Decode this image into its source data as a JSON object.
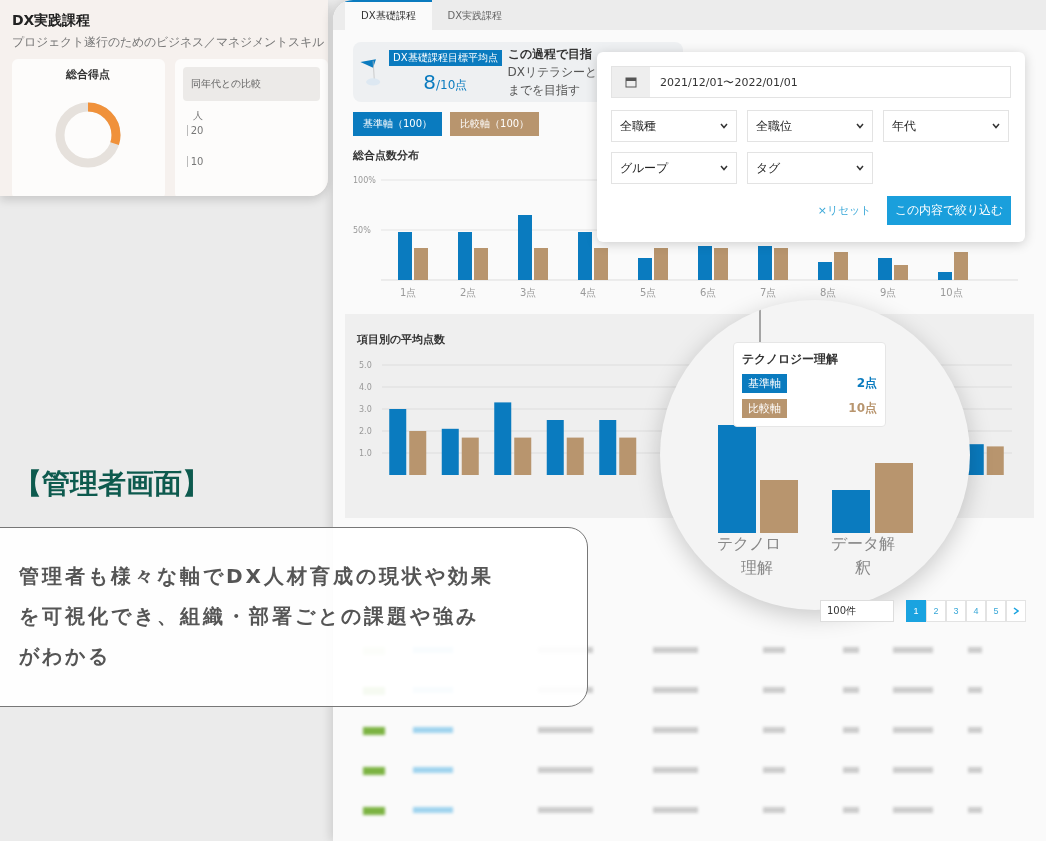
{
  "back_screen": {
    "title": "DX実践課程",
    "subtitle": "プロジェクト遂行のためのビジネス／マネジメントスキル",
    "score_card": {
      "title": "総合得点",
      "level": 0.3
    },
    "comparison_card": {
      "title": "同年代との比較",
      "unit": "人",
      "yticks": [
        "20",
        "10"
      ]
    }
  },
  "main_screen": {
    "tabs": [
      {
        "label": "DX基礎課程",
        "selected": true
      },
      {
        "label": "DX実践課程",
        "selected": false
      }
    ],
    "goal": {
      "badge": "DX基礎課程目標平均点",
      "score": "8",
      "max": "/10点",
      "heading": "この過程で目指",
      "lines": [
        "DXリテラシーと",
        "までを目指す"
      ]
    },
    "axes": [
      {
        "label": "基準軸（100）",
        "color": "#0a7bbf"
      },
      {
        "label": "比較軸（100）",
        "color": "#b8956e"
      }
    ],
    "distribution": {
      "title": "総合点数分布",
      "chart_data": {
        "type": "bar",
        "categories": [
          "1点",
          "2点",
          "3点",
          "4点",
          "5点",
          "6点",
          "7点",
          "8点",
          "9点",
          "10点"
        ],
        "series": [
          {
            "color": "#0a7bbf",
            "values": [
              48,
              48,
              65,
              48,
              22,
              34,
              34,
              18,
              22,
              8
            ]
          },
          {
            "color": "#b8956e",
            "values": [
              32,
              32,
              32,
              32,
              32,
              32,
              32,
              28,
              15,
              28
            ]
          }
        ],
        "ylim": [
          0,
          100
        ],
        "yticks": [
          {
            "value": 50,
            "label": "50%"
          },
          {
            "value": 100,
            "label": "100%"
          }
        ],
        "grid": true
      }
    },
    "filter": {
      "date": "2021/12/01〜2022/01/01",
      "selects": [
        "全職種",
        "全職位",
        "年代",
        "グループ",
        "タグ"
      ],
      "reset": "×リセット",
      "apply": "この内容で絞り込む"
    },
    "item_scores": {
      "title": "項目別の平均点数",
      "chart_data": {
        "type": "bar",
        "series": [
          {
            "color": "#0a7bbf",
            "values": [
              3.0,
              2.1,
              3.3,
              2.5,
              2.5,
              null,
              null,
              null,
              null,
              null,
              null,
              1.4
            ]
          },
          {
            "color": "#b8956e",
            "values": [
              2.0,
              1.7,
              1.7,
              1.7,
              1.7,
              null,
              null,
              null,
              null,
              null,
              null,
              1.3
            ]
          }
        ],
        "ylim": [
          0,
          5
        ],
        "yticks": [
          {
            "value": 1,
            "label": "1.0"
          },
          {
            "value": 2,
            "label": "2.0"
          },
          {
            "value": 3,
            "label": "3.0"
          },
          {
            "value": 4,
            "label": "4.0"
          },
          {
            "value": 5,
            "label": "5.0"
          }
        ],
        "grid": true
      }
    },
    "magnifier": {
      "title": "テクノロジー理解",
      "rows": [
        {
          "label": "基準軸",
          "value": "2点",
          "color": "#0a7bbf"
        },
        {
          "label": "比較軸",
          "value": "10点",
          "color": "#b8956e"
        }
      ],
      "labels": [
        [
          "テクノロ",
          "理解"
        ],
        [
          "データ解",
          "釈"
        ]
      ]
    },
    "pagination": {
      "per_page": "100件",
      "pages": [
        {
          "label": "1",
          "selected": true
        },
        {
          "label": "2",
          "selected": false
        },
        {
          "label": "3",
          "selected": false
        },
        {
          "label": "4",
          "selected": false
        },
        {
          "label": "5",
          "selected": false
        }
      ]
    }
  },
  "promo": {
    "heading": "【管理者画面】",
    "description": "管理者も様々な軸でDX人材育成の現状や効果を可視化でき、組織・部署ごとの課題や強みがわかる"
  }
}
